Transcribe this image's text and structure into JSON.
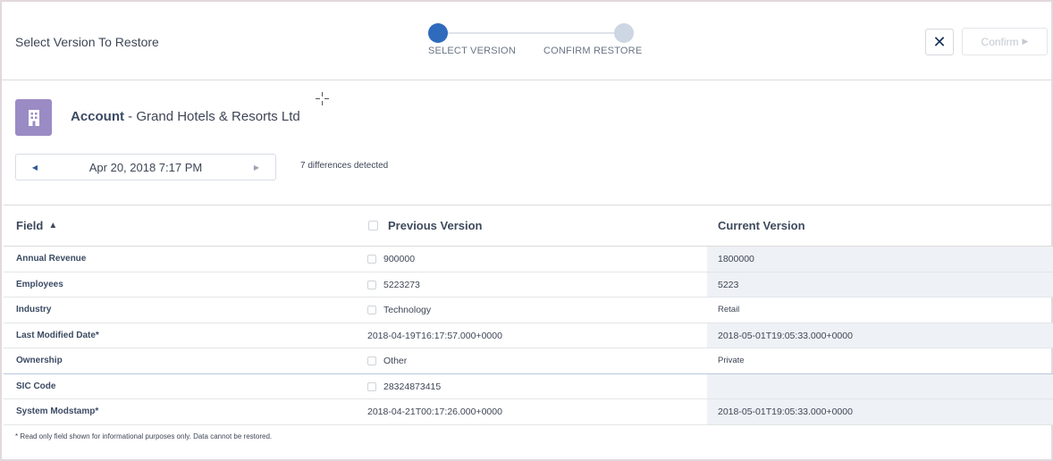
{
  "header": {
    "title": "Select Version To Restore",
    "steps": [
      {
        "label": "SELECT VERSION",
        "active": true
      },
      {
        "label": "CONFIRM RESTORE",
        "active": false
      }
    ],
    "confirm_label": "Confirm",
    "close_glyph": "✕",
    "confirm_glyph": "▶"
  },
  "record": {
    "object": "Account",
    "separator": " - ",
    "name": "Grand Hotels & Resorts Ltd",
    "icon": "building-icon",
    "icon_color": "#9b8bc5"
  },
  "version_nav": {
    "date": "Apr 20, 2018 7:17 PM",
    "prev_glyph": "◀",
    "next_glyph": "▶"
  },
  "diff_summary": "7 differences detected",
  "table": {
    "columns": {
      "field": "Field",
      "sort_glyph": "▲",
      "previous": "Previous Version",
      "current": "Current Version"
    },
    "rows": [
      {
        "field": "Annual Revenue",
        "previous": "900000",
        "current": "1800000",
        "restorable": true
      },
      {
        "field": "Employees",
        "previous": "5223273",
        "current": "5223",
        "restorable": true
      },
      {
        "field": "Industry",
        "previous": "Technology",
        "current": "Retail",
        "restorable": true
      },
      {
        "field": "Last Modified Date*",
        "previous": "2018-04-19T16:17:57.000+0000",
        "current": "2018-05-01T19:05:33.000+0000",
        "restorable": false
      },
      {
        "field": "Ownership",
        "previous": "Other",
        "current": "Private",
        "restorable": true
      },
      {
        "field": "SIC Code",
        "previous": "28324873415",
        "current": "",
        "restorable": true
      },
      {
        "field": "System Modstamp*",
        "previous": "2018-04-21T00:17:26.000+0000",
        "current": "2018-05-01T19:05:33.000+0000",
        "restorable": false
      }
    ]
  },
  "footnote": "* Read only field shown for informational purposes only. Data cannot be restored.",
  "colors": {
    "accent": "#2f6bbd",
    "step_inactive": "#cdd6e3",
    "current_column_bg": "#eef1f5"
  }
}
